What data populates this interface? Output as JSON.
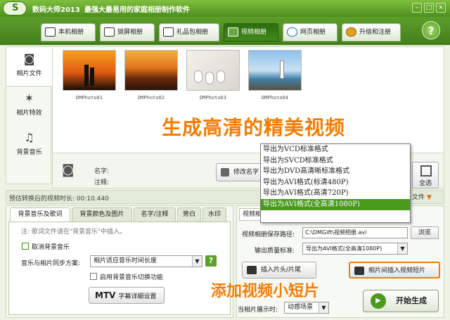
{
  "app": {
    "title": "数码大师2013",
    "slogan": "最强大最易用的家庭相册制作软件",
    "window_buttons": [
      "minimize-icon",
      "maximize-icon",
      "close-icon"
    ]
  },
  "tabs": [
    {
      "label": "本机相册",
      "icon": "album-icon"
    },
    {
      "label": "锁屏相册",
      "icon": "monitor-icon"
    },
    {
      "label": "礼品包相册",
      "icon": "gift-icon"
    },
    {
      "label": "视频相册",
      "icon": "film-icon",
      "active": true
    },
    {
      "label": "网页相册",
      "icon": "ie-icon"
    },
    {
      "label": "升级和注册",
      "icon": "key-icon"
    }
  ],
  "help_glyph": "?",
  "sidebar": {
    "items": [
      {
        "label": "相片文件",
        "icon": "camera-icon"
      },
      {
        "label": "相片特效",
        "icon": "effects-icon"
      },
      {
        "label": "背景音乐",
        "icon": "music-icon"
      }
    ]
  },
  "photos": [
    {
      "name": "DMPhoto01",
      "scene": "sunset-couple"
    },
    {
      "name": "DMPhoto02",
      "scene": "sunset-sea"
    },
    {
      "name": "DMPhoto03",
      "scene": "shoes"
    },
    {
      "name": "DMPhoto04",
      "scene": "lighthouse"
    }
  ],
  "overlay_caption": "生成高清的精美视频",
  "info": {
    "name_label": "名字:",
    "note_label": "注释:",
    "edit_label": "修改名字",
    "select_all_label": "全选"
  },
  "quality_options": [
    "导出为VCD标准格式",
    "导出为SVCD标准格式",
    "导出为DVD高清晰标准格式",
    "导出为AVI格式(标清480P)",
    "导出为AVI格式(高清720P)",
    "导出为AVI格式(全高清1080P)"
  ],
  "status": {
    "text": "预估转换后的视频时长: 00:10.440",
    "more_files": "文件"
  },
  "subtabs": [
    "背景音乐及歌词",
    "背景颜色及图片",
    "名字/注释",
    "旁白",
    "水印"
  ],
  "music": {
    "note": "注: 歌词文件请在\"背景音乐\"中插入。",
    "cancel_bg_music": "取消背景音乐",
    "sync_label": "音乐与相片同步方案:",
    "sync_value": "相片适应音乐时间长度",
    "help_glyph": "?",
    "enable_switch": "启用背景音乐切换功能",
    "mtv_prefix": "MTV",
    "mtv_label": "字幕详细设置"
  },
  "right": {
    "tab_label": "视频相册",
    "save_path_label": "视频相册保存路径:",
    "save_path_value": "C:\\DMGift\\视频相册.avi",
    "browse": "浏览",
    "quality_label": "输出质量标准:",
    "quality_value": "导出为AVI格式(全高清1080P)",
    "insert_intro": "插入片头/片尾",
    "insert_clip": "相片间插入视频短片",
    "add_caption": "添加视频小短片",
    "display_label": "当相片展示时:",
    "display_value": "动感场景",
    "start": "开始生成"
  }
}
